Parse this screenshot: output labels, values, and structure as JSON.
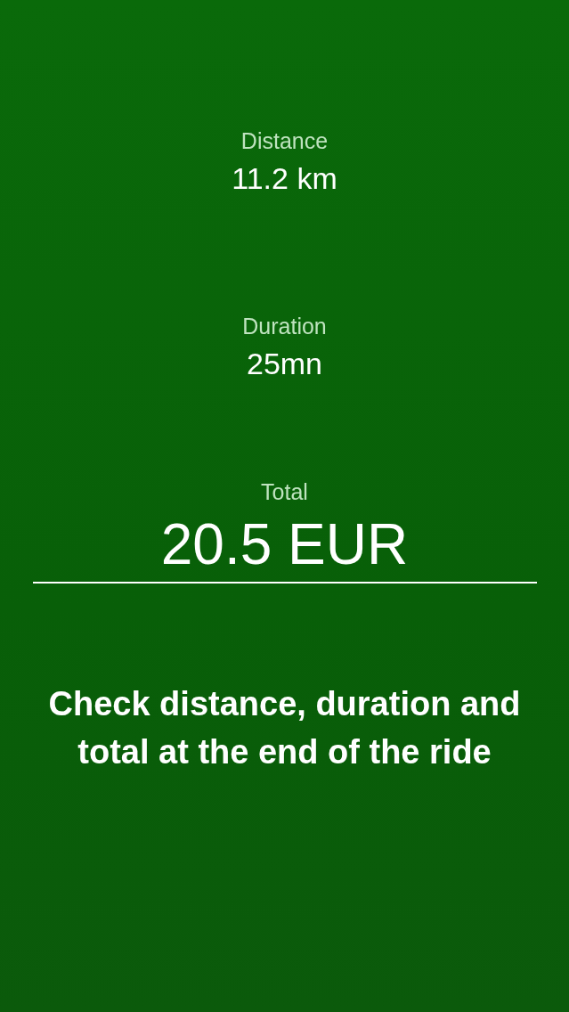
{
  "metrics": [
    {
      "label": "Distance",
      "value": "11.2 km",
      "kind": "small"
    },
    {
      "label": "Duration",
      "value": "25mn",
      "kind": "small"
    },
    {
      "label": "Total",
      "value": "20.5 EUR",
      "kind": "large"
    }
  ],
  "caption": "Check distance, duration and total at the end of the ride"
}
